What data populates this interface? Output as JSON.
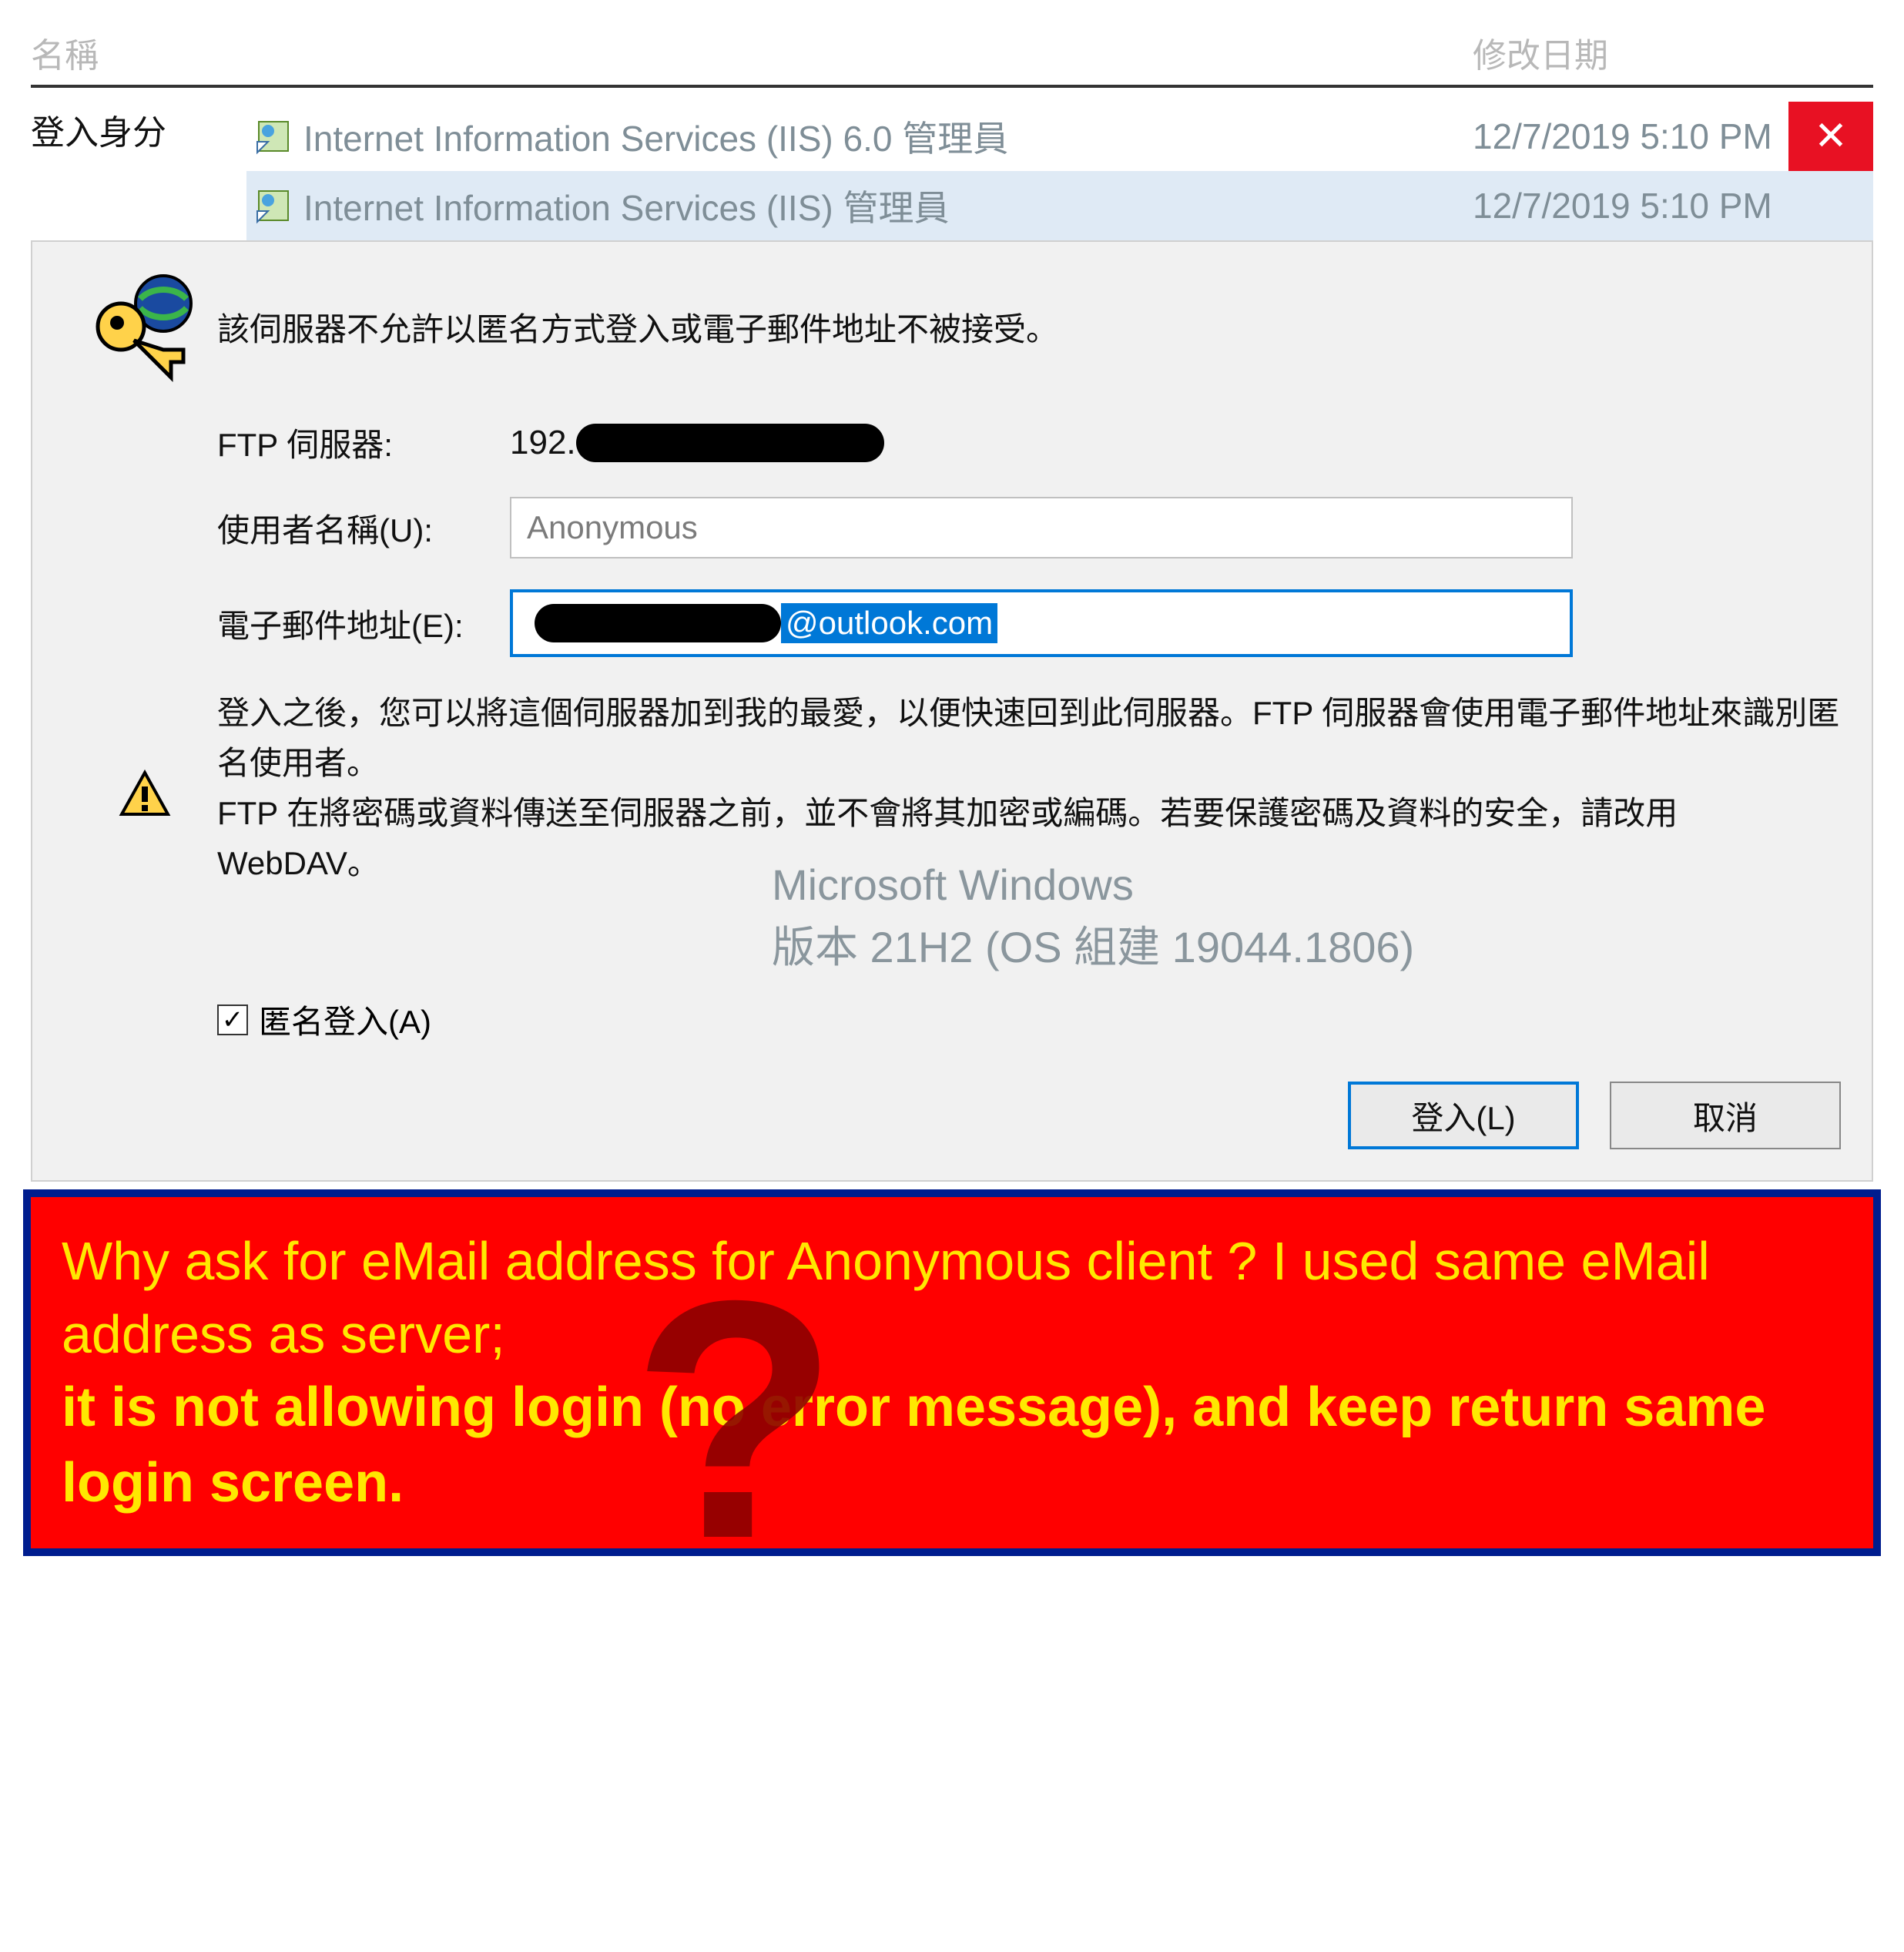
{
  "columns": {
    "col1": "名稱",
    "col2": "",
    "col3": "修改日期"
  },
  "left_label": "登入身分",
  "rows": [
    {
      "name": "Internet Information Services (IIS) 6.0 管理員",
      "date": "12/7/2019 5:10 PM",
      "selected": false
    },
    {
      "name": "Internet Information Services (IIS) 管理員",
      "date": "12/7/2019 5:10 PM",
      "selected": true
    }
  ],
  "close_x": "✕",
  "dialog": {
    "error": "該伺服器不允許以匿名方式登入或電子郵件地址不被接受。",
    "ftp_label": "FTP 伺服器:",
    "ftp_value_prefix": "192.",
    "user_label": "使用者名稱(U):",
    "user_placeholder": "Anonymous",
    "email_label": "電子郵件地址(E):",
    "email_value_visible": "@outlook.com",
    "desc1": "登入之後，您可以將這個伺服器加到我的最愛，以便快速回到此伺服器。FTP 伺服器會使用電子郵件地址來識別匿名使用者。",
    "desc2": "FTP 在將密碼或資料傳送至伺服器之前，並不會將其加密或編碼。若要保護密碼及資料的安全，請改用 WebDAV。",
    "ms_line1": "Microsoft Windows",
    "ms_line2": "版本 21H2 (OS 組建 19044.1806)",
    "anon_label": "匿名登入(A)",
    "anon_checked": true,
    "login_btn": "登入(L)",
    "cancel_btn": "取消"
  },
  "annotation": {
    "line1": "Why ask for eMail address for Anonymous client ?  I used same eMail address as server;",
    "line2": "it is not allowing login (no error message), and keep return same login screen.",
    "qmark": "?"
  }
}
